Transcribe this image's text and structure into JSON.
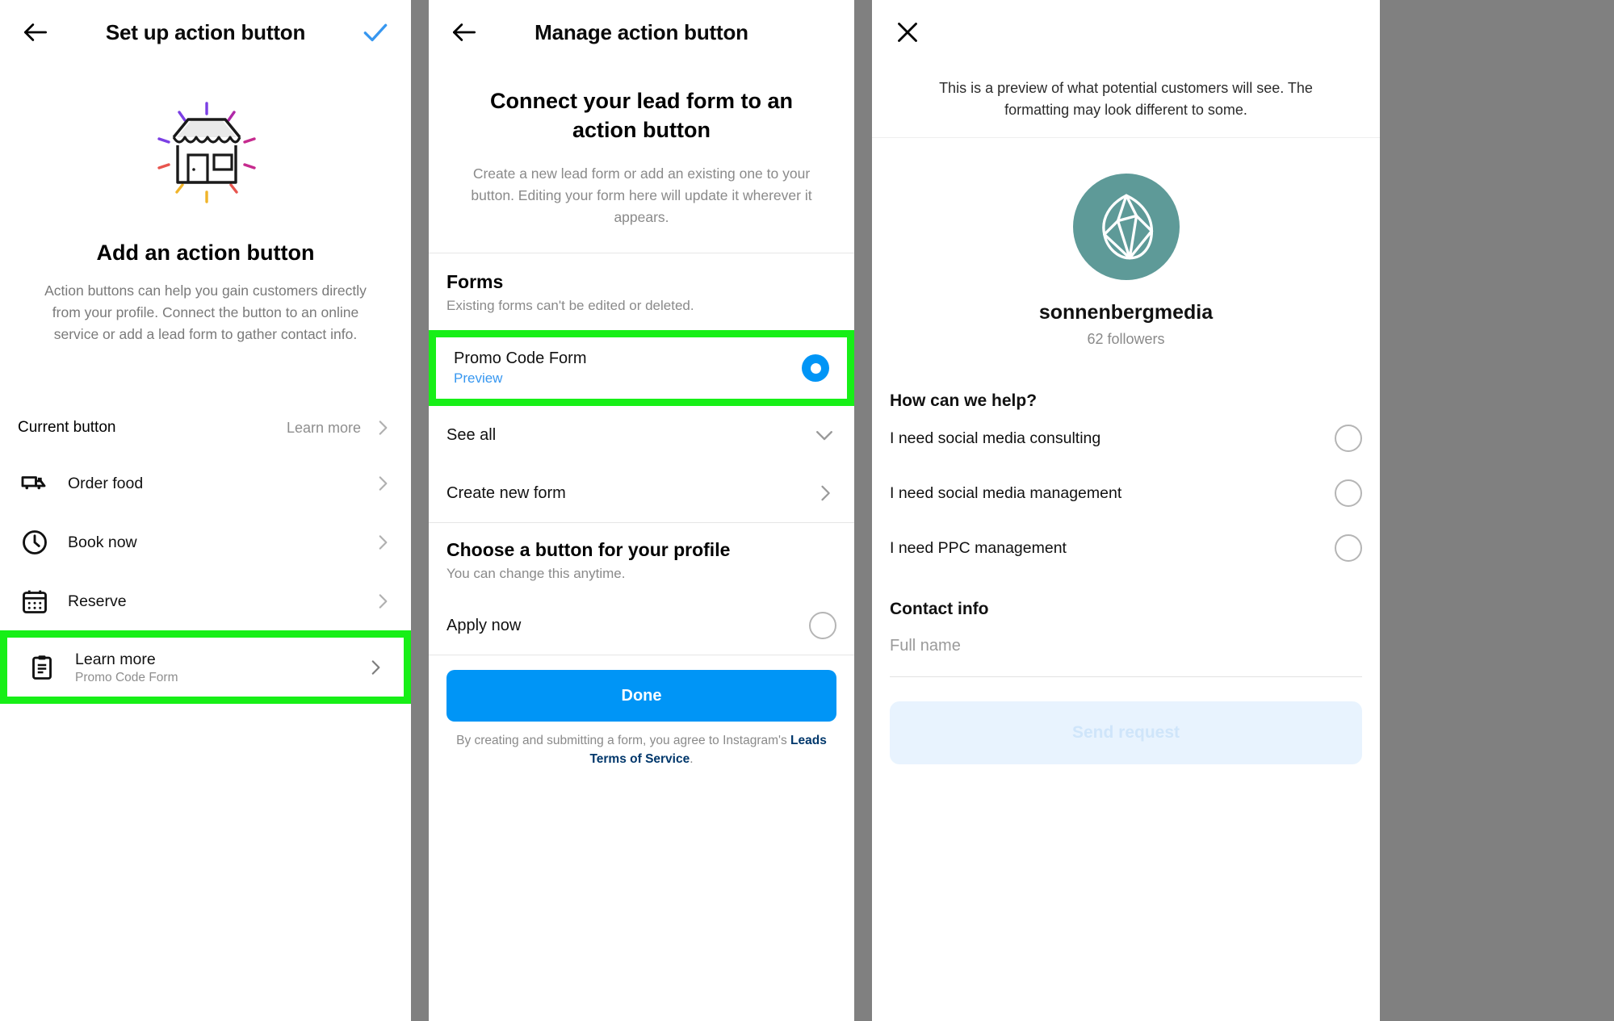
{
  "panels": {
    "left": {
      "header": {
        "back_icon": "arrow-left-icon",
        "title": "Set up action button",
        "confirm_icon": "check-icon",
        "accent": "#3797f0"
      },
      "hero": {
        "illustration": "storefront-icon",
        "title": "Add an action button",
        "description": "Action buttons can help you gain customers directly from your profile. Connect the button to an online service or add a lead form to gather contact info."
      },
      "current_button": {
        "label": "Current button",
        "link": "Learn more",
        "chevron": "chevron-right-icon"
      },
      "options": [
        {
          "icon": "delivery-truck-icon",
          "label": "Order food",
          "sub": "",
          "highlighted": false
        },
        {
          "icon": "clock-icon",
          "label": "Book now",
          "sub": "",
          "highlighted": false
        },
        {
          "icon": "calendar-icon",
          "label": "Reserve",
          "sub": "",
          "highlighted": false
        },
        {
          "icon": "clipboard-icon",
          "label": "Learn more",
          "sub": "Promo Code Form",
          "highlighted": true
        }
      ],
      "highlight_color": "#17ef17"
    },
    "mid": {
      "header": {
        "back_icon": "arrow-left-icon",
        "title": "Manage action button"
      },
      "intro": {
        "title": "Connect your lead form to an action button",
        "description": "Create a new lead form or add an existing one to your button. Editing your form here will update it wherever it appears."
      },
      "forms_section": {
        "title": "Forms",
        "subtitle": "Existing forms can't be edited or deleted.",
        "form": {
          "name": "Promo Code Form",
          "preview_link": "Preview",
          "selected": true,
          "highlighted": true
        },
        "see_all": {
          "label": "See all",
          "icon": "chevron-down-icon"
        },
        "create_new": {
          "label": "Create new form",
          "icon": "chevron-right-icon"
        }
      },
      "choose_section": {
        "title": "Choose a button for your profile",
        "subtitle": "You can change this anytime.",
        "option": {
          "label": "Apply now",
          "selected": false
        }
      },
      "done_button": "Done",
      "tos": {
        "prefix": "By creating and submitting a form, you agree to Instagram's ",
        "link": "Leads Terms of Service",
        "suffix": "."
      },
      "accent": "#0095f6",
      "highlight_color": "#17ef17"
    },
    "right": {
      "header": {
        "close_icon": "close-icon"
      },
      "preview_note": "This is a preview of what potential customers will see. The formatting may look different to some.",
      "profile": {
        "avatar_icon": "leaf-logo-icon",
        "avatar_color": "#5e9a98",
        "handle": "sonnenbergmedia",
        "followers": "62 followers"
      },
      "question": {
        "title": "How can we help?",
        "options": [
          {
            "label": "I need social media consulting",
            "selected": false
          },
          {
            "label": "I need social media management",
            "selected": false
          },
          {
            "label": "I need PPC management",
            "selected": false
          }
        ]
      },
      "contact": {
        "title": "Contact info",
        "full_name_placeholder": "Full name"
      },
      "send_button": "Send request"
    }
  }
}
